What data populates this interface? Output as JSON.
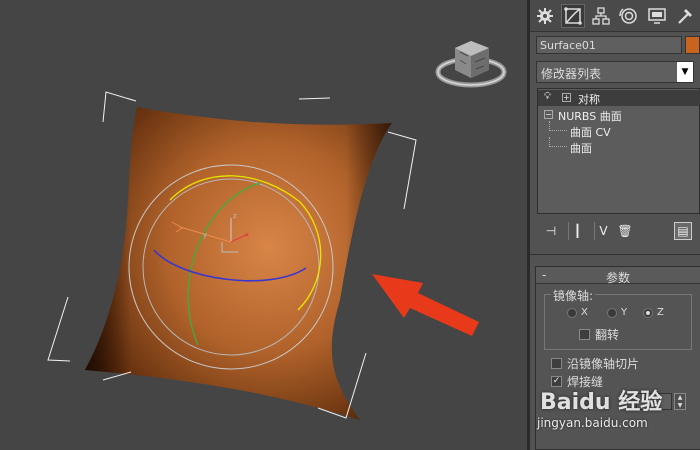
{
  "viewport": {
    "background": "#454545",
    "surface_color": "#b0622a",
    "arrow_color": "#e8391a"
  },
  "command_panel": {
    "tabs": [
      "create-icon",
      "modify-icon",
      "hierarchy-icon",
      "motion-icon",
      "display-icon",
      "utilities-icon"
    ],
    "active_tab": "modify-icon",
    "object_name": "Surface01",
    "object_color": "#c8641e",
    "modifier_list_label": "修改器列表",
    "stack": [
      {
        "label": "对称",
        "type": "modifier"
      },
      {
        "label": "NURBS 曲面",
        "type": "base"
      },
      {
        "label": "曲面 CV",
        "type": "sub"
      },
      {
        "label": "曲面",
        "type": "sub"
      }
    ]
  },
  "rollout": {
    "title": "参数",
    "mirror_axis_label": "镜像轴:",
    "axes": [
      {
        "label": "X",
        "selected": false
      },
      {
        "label": "Y",
        "selected": false
      },
      {
        "label": "Z",
        "selected": true
      }
    ],
    "flip_label": "翻转",
    "slice_label": "沿镜像轴切片",
    "weld_label": "焊接缝"
  },
  "watermark": {
    "brand": "Baidu 经验",
    "url": "jingyan.baidu.com"
  }
}
